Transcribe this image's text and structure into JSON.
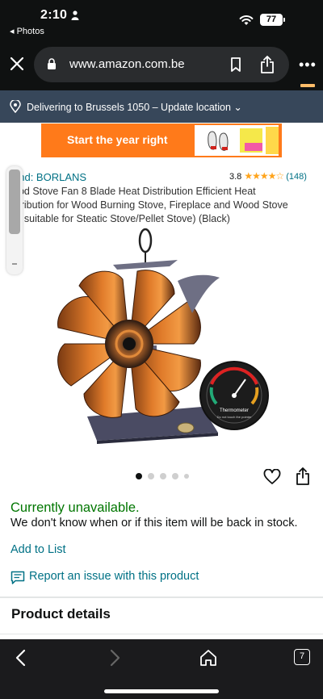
{
  "status_bar": {
    "time": "2:10",
    "back_app": "◂ Photos",
    "battery": "77"
  },
  "browser": {
    "url": "www.amazon.com.be",
    "open_tabs": "7"
  },
  "delivery": {
    "text": "Delivering to Brussels 1050 – Update location ⌄"
  },
  "banner": {
    "text": "Start the year right"
  },
  "product": {
    "brand": "and: BORLANS",
    "rating_value": "3.8",
    "rating_stars": "★★★★☆",
    "rating_count": "(148)",
    "title_lines": [
      "ood Stove Fan 8 Blade Heat Distribution Efficient Heat",
      "stribution for Wood Burning Stove, Fireplace and Wood Stove",
      "ot suitable for Steatic Stove/Pellet Stove) (Black)"
    ],
    "gauge_label": "Thermometer",
    "gauge_sublabel": "Do not touch the pointer",
    "image_count": 5,
    "image_index": 0
  },
  "availability": {
    "status": "Currently unavailable.",
    "note": "We don't know when or if this item will be back in stock."
  },
  "actions": {
    "add_to_list": "Add to List",
    "report_issue": "Report an issue with this product"
  },
  "sections": {
    "product_details": "Product details"
  },
  "colors": {
    "amazon_dark": "#0f1111",
    "delivery_bar": "#37475a",
    "link": "#007185",
    "in_stock_green": "#007600",
    "banner_orange": "#ff7a1a",
    "star": "#ffa41c"
  }
}
